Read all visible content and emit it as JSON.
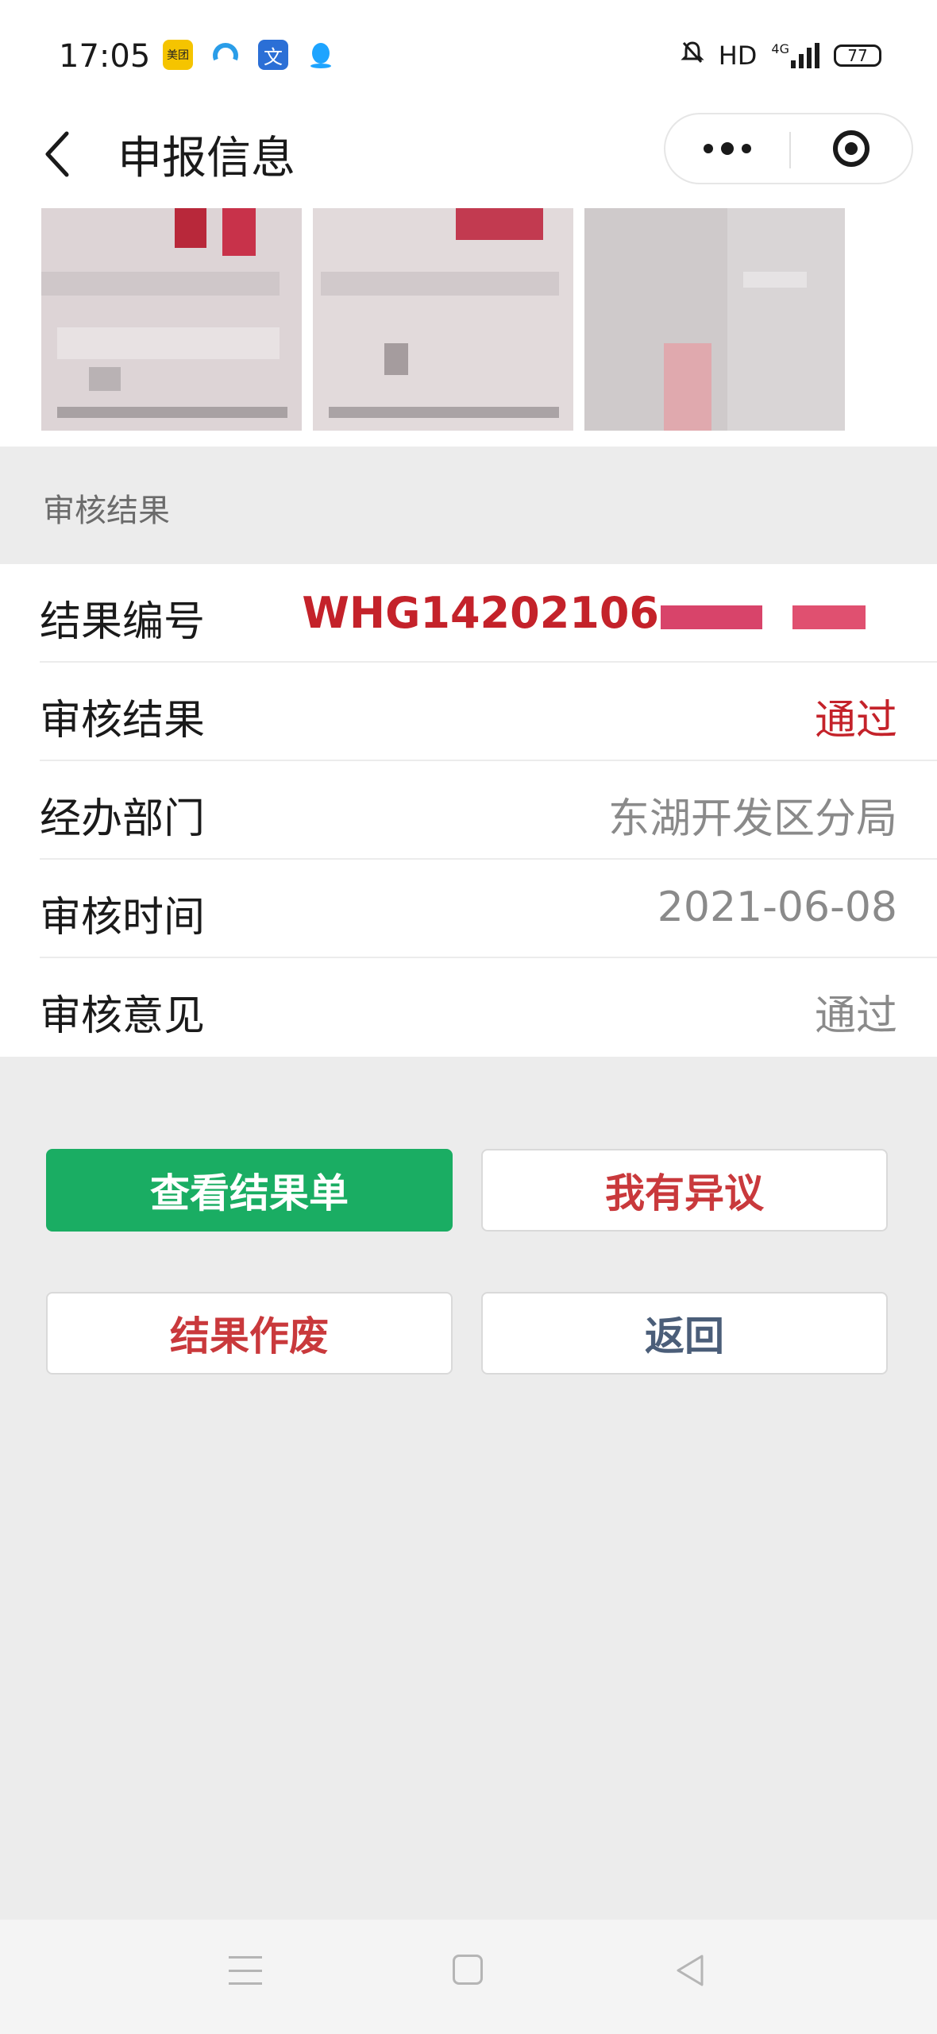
{
  "status_bar": {
    "time": "17:05",
    "network": "HD",
    "signal_label": "4G",
    "battery": "77",
    "apps": [
      {
        "icon": "meituan-icon",
        "text": "美团",
        "color": "#f5c400"
      },
      {
        "icon": "browser-icon",
        "text": "",
        "color": "#2a9de8"
      },
      {
        "icon": "translate-icon",
        "text": "文",
        "color": "#2b6fd6"
      },
      {
        "icon": "qq-icon",
        "text": "",
        "color": "#1ea4ff"
      }
    ]
  },
  "header": {
    "title": "申报信息",
    "back_icon": "chevron-left-icon",
    "more_icon": "more-dots-icon",
    "close_icon": "target-icon"
  },
  "section": {
    "title": "审核结果"
  },
  "info": {
    "rows": [
      {
        "label": "结果编号",
        "value": "WHG14202106"
      },
      {
        "label": "审核结果",
        "value": "通过"
      },
      {
        "label": "经办部门",
        "value": "东湖开发区分局"
      },
      {
        "label": "审核时间",
        "value": "2021-06-08"
      },
      {
        "label": "审核意见",
        "value": "通过"
      }
    ]
  },
  "buttons": {
    "view_result": "查看结果单",
    "objection": "我有异议",
    "void_result": "结果作废",
    "back": "返回"
  },
  "colors": {
    "accent_green": "#1aad63",
    "accent_red": "#c4222a",
    "background": "#ececec"
  }
}
